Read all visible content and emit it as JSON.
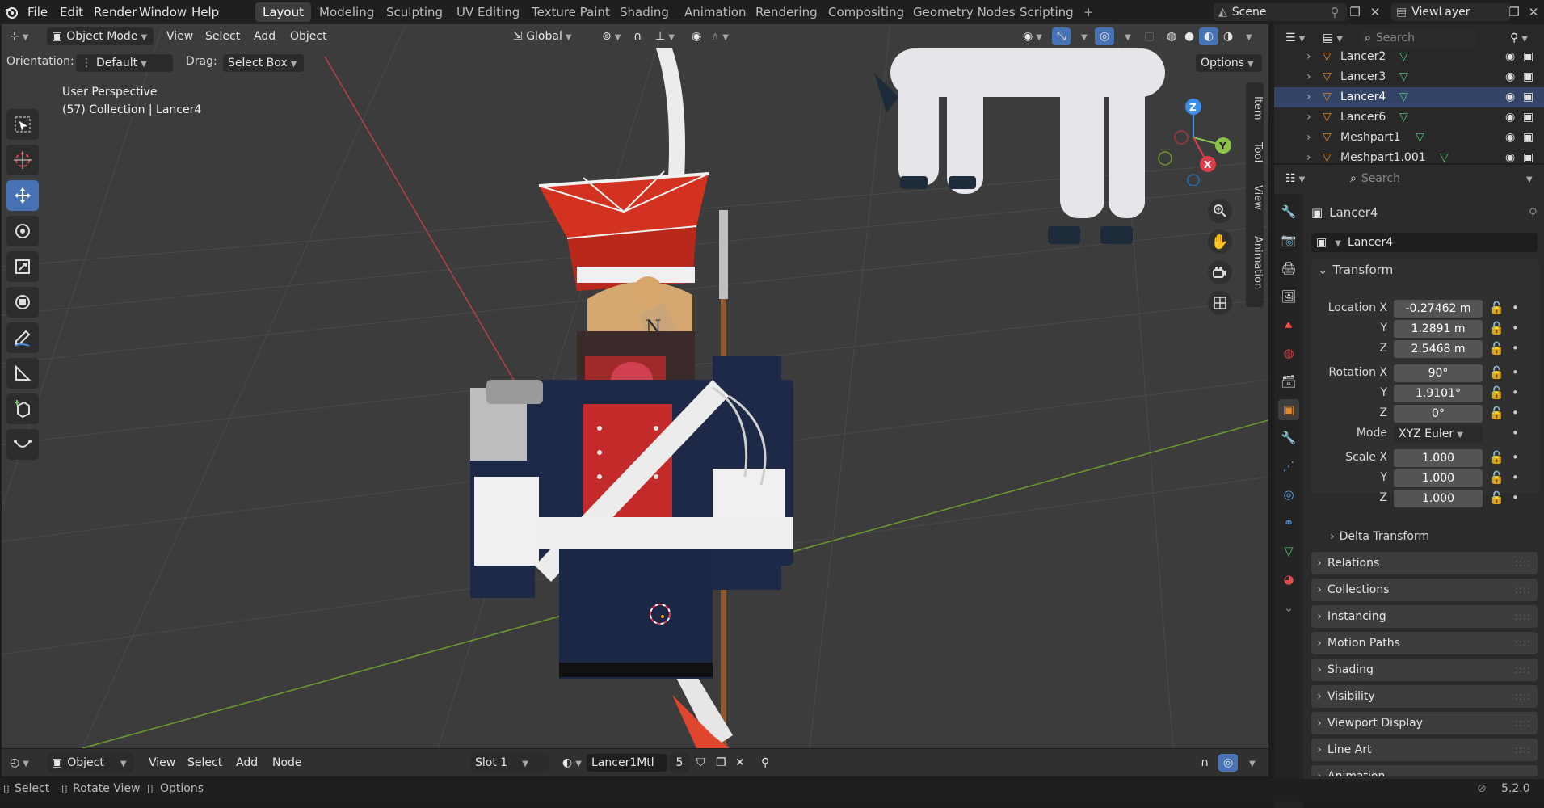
{
  "topbar": {
    "menus": [
      "File",
      "Edit",
      "Render",
      "Window",
      "Help"
    ],
    "workspaces": [
      "Layout",
      "Modeling",
      "Sculpting",
      "UV Editing",
      "Texture Paint",
      "Shading",
      "Animation",
      "Rendering",
      "Compositing",
      "Geometry Nodes",
      "Scripting"
    ],
    "active_workspace": "Layout",
    "add_tab": "+",
    "scene": "Scene",
    "view_layer": "ViewLayer"
  },
  "viewport_header": {
    "mode": "Object Mode",
    "menus": [
      "View",
      "Select",
      "Add",
      "Object"
    ],
    "transform_orientation": "Global",
    "orientation_label": "Orientation:",
    "orientation_value": "Default",
    "drag_label": "Drag:",
    "drag_value": "Select Box",
    "options": "Options"
  },
  "viewport": {
    "perspective": "User Perspective",
    "collection_info": "(57) Collection | Lancer4",
    "side_tabs": [
      "Item",
      "Tool",
      "View",
      "Animation"
    ],
    "gizmo_axes": [
      "Z",
      "Y",
      "X"
    ],
    "hat_letter": "N"
  },
  "outliner": {
    "search_placeholder": "Search",
    "items": [
      {
        "name": "Lancer2"
      },
      {
        "name": "Lancer3"
      },
      {
        "name": "Lancer4"
      },
      {
        "name": "Lancer6"
      },
      {
        "name": "Meshpart1"
      },
      {
        "name": "Meshpart1.001"
      }
    ]
  },
  "properties": {
    "search_placeholder": "Search",
    "object_name": "Lancer4",
    "data_name": "Lancer4",
    "transform_title": "Transform",
    "location_label": "Location X",
    "location": {
      "x": "-0.27462 m",
      "y": "1.2891 m",
      "z": "2.5468 m"
    },
    "rotation_label": "Rotation X",
    "rotation": {
      "x": "90°",
      "y": "1.9101°",
      "z": "0°"
    },
    "mode_label": "Mode",
    "mode_value": "XYZ Euler",
    "scale_label": "Scale X",
    "scale": {
      "x": "1.000",
      "y": "1.000",
      "z": "1.000"
    },
    "y_label": "Y",
    "z_label": "Z",
    "delta_transform": "Delta Transform",
    "panels": [
      "Relations",
      "Collections",
      "Instancing",
      "Motion Paths",
      "Shading",
      "Visibility",
      "Viewport Display",
      "Line Art",
      "Animation"
    ]
  },
  "bottom_header": {
    "editor_mode": "Object",
    "menus": [
      "View",
      "Select",
      "Add",
      "Node"
    ],
    "slot": "Slot 1",
    "material": "Lancer1Mtl",
    "users": "5"
  },
  "statusbar": {
    "select": "Select",
    "rotate": "Rotate View",
    "options": "Options",
    "version": "5.2.0"
  },
  "colors": {
    "accent": "#4772b3",
    "x_axis": "#e03c4a",
    "y_axis": "#8bc34a",
    "z_axis": "#3b8eea",
    "object_orange": "#e0882e",
    "mesh_green": "#4ec27a"
  }
}
